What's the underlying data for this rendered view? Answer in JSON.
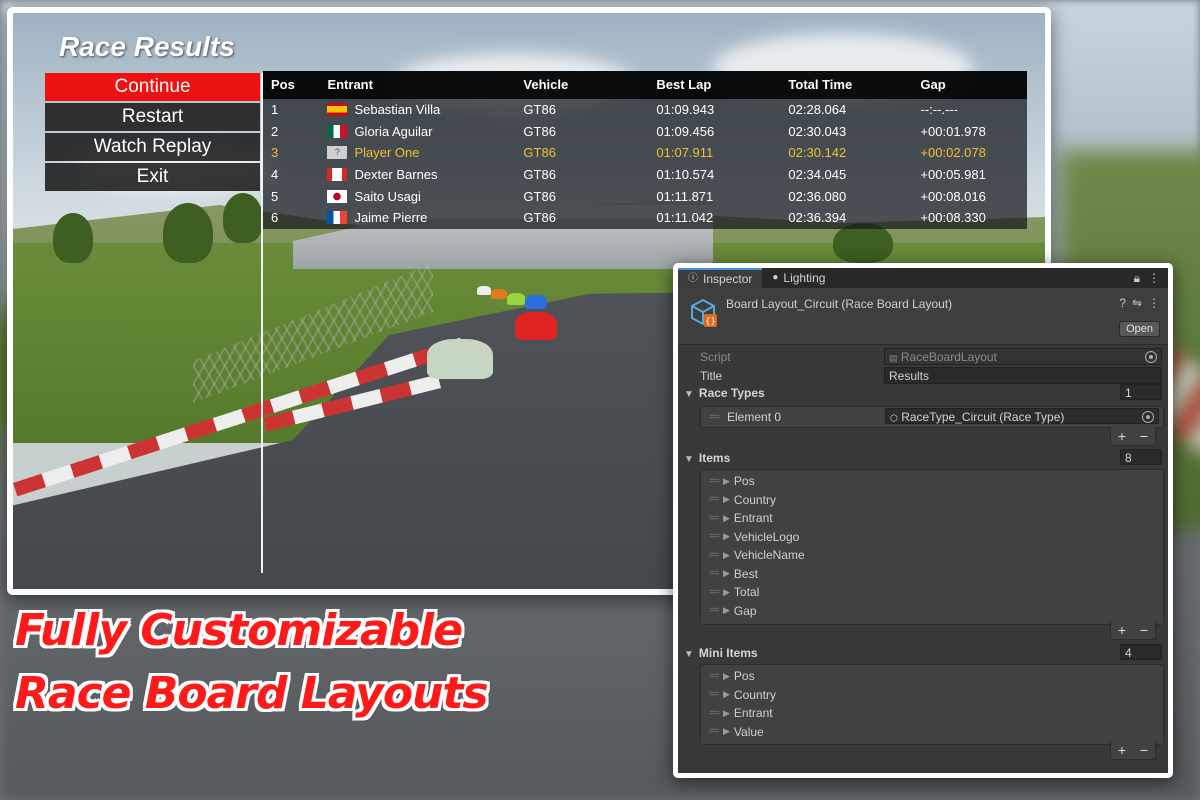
{
  "race_ui": {
    "title": "Race Results",
    "menu": [
      {
        "label": "Continue"
      },
      {
        "label": "Restart"
      },
      {
        "label": "Watch Replay"
      },
      {
        "label": "Exit"
      }
    ],
    "columns": [
      "Pos",
      "Entrant",
      "Vehicle",
      "Best Lap",
      "Total Time",
      "Gap"
    ],
    "rows": [
      {
        "pos": "1",
        "entrant": "Sebastian Villa",
        "vehicle": "GT86",
        "best": "01:09.943",
        "total": "02:28.064",
        "gap": "--:--.---",
        "flag": "spain"
      },
      {
        "pos": "2",
        "entrant": "Gloria Aguilar",
        "vehicle": "GT86",
        "best": "01:09.456",
        "total": "02:30.043",
        "gap": "+00:01.978",
        "flag": "mexico"
      },
      {
        "pos": "3",
        "entrant": "Player One",
        "vehicle": "GT86",
        "best": "01:07.911",
        "total": "02:30.142",
        "gap": "+00:02.078",
        "flag": "unknown"
      },
      {
        "pos": "4",
        "entrant": "Dexter Barnes",
        "vehicle": "GT86",
        "best": "01:10.574",
        "total": "02:34.045",
        "gap": "+00:05.981",
        "flag": "canada"
      },
      {
        "pos": "5",
        "entrant": "Saito Usagi",
        "vehicle": "GT86",
        "best": "01:11.871",
        "total": "02:36.080",
        "gap": "+00:08.016",
        "flag": "japan"
      },
      {
        "pos": "6",
        "entrant": "Jaime Pierre",
        "vehicle": "GT86",
        "best": "01:11.042",
        "total": "02:36.394",
        "gap": "+00:08.330",
        "flag": "france"
      }
    ],
    "unknown_flag_glyph": "?"
  },
  "inspector": {
    "tabs": [
      {
        "label": "Inspector"
      },
      {
        "label": "Lighting"
      }
    ],
    "object_title": "Board Layout_Circuit (Race Board Layout)",
    "open_label": "Open",
    "script_label": "Script",
    "script_value": "RaceBoardLayout",
    "title_label": "Title",
    "title_value": "Results",
    "race_types": {
      "label": "Race Types",
      "count": "1",
      "elements": [
        {
          "label": "Element 0",
          "value": "RaceType_Circuit (Race Type)"
        }
      ]
    },
    "items": {
      "label": "Items",
      "count": "8",
      "entries": [
        "Pos",
        "Country",
        "Entrant",
        "VehicleLogo",
        "VehicleName",
        "Best",
        "Total",
        "Gap"
      ]
    },
    "mini_items": {
      "label": "Mini Items",
      "count": "4",
      "entries": [
        "Pos",
        "Country",
        "Entrant",
        "Value"
      ]
    },
    "plus": "+",
    "minus": "−"
  },
  "promo": {
    "line1": "Fully Customizable",
    "line2": "Race Board Layouts"
  },
  "colors": {
    "accent_red": "#ee1111",
    "player_highlight": "#f2c02c",
    "promo_red": "#ff1a1a",
    "inspector_bg": "#383838"
  }
}
